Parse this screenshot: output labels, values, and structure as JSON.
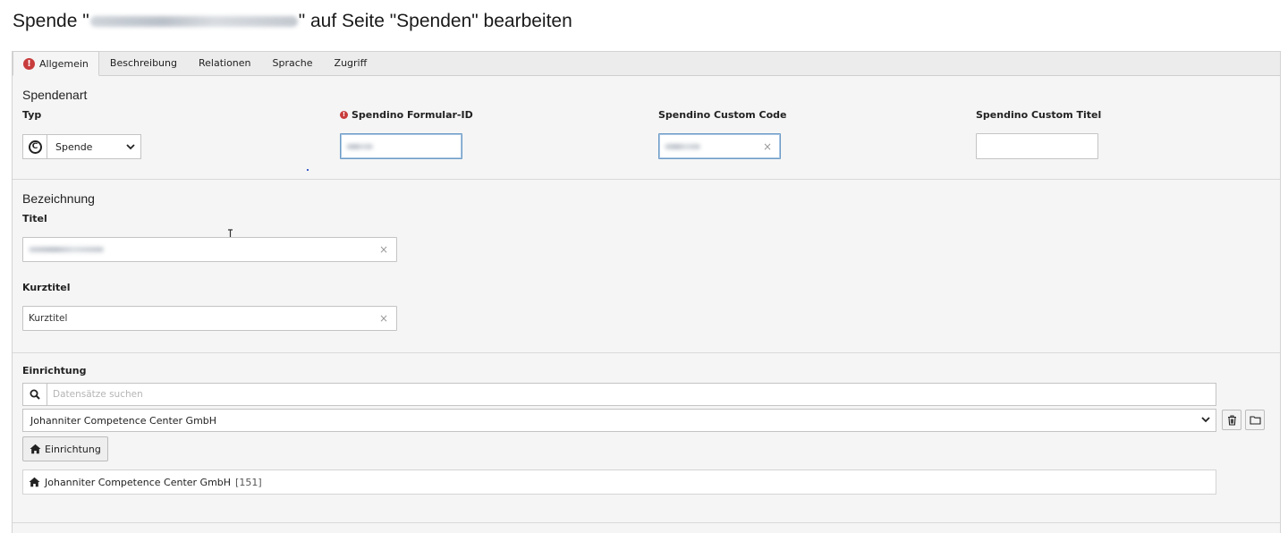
{
  "header": {
    "title_prefix": "Spende \"",
    "title_suffix": "\" auf Seite \"Spenden\" bearbeiten"
  },
  "tabs": [
    {
      "label": "Allgemein",
      "active": true,
      "has_error": true
    },
    {
      "label": "Beschreibung"
    },
    {
      "label": "Relationen"
    },
    {
      "label": "Sprache"
    },
    {
      "label": "Zugriff"
    }
  ],
  "section_spendenart": {
    "legend": "Spendenart",
    "typ": {
      "label": "Typ",
      "value": "Spende",
      "icon": "copyright-icon"
    },
    "formular_id": {
      "label": "Spendino Formular-ID",
      "required_error": true
    },
    "custom_code": {
      "label": "Spendino Custom Code"
    },
    "custom_titel": {
      "label": "Spendino Custom Titel",
      "value": ""
    }
  },
  "section_bezeichnung": {
    "legend": "Bezeichnung",
    "titel": {
      "label": "Titel"
    },
    "kurztitel": {
      "label": "Kurztitel",
      "value": "Kurztitel"
    }
  },
  "section_einrichtung": {
    "label": "Einrichtung",
    "search_placeholder": "Datensätze suchen",
    "selected_option": "Johanniter Competence Center GmbH",
    "add_button_label": "Einrichtung",
    "result": {
      "label": "Johanniter Competence Center GmbH",
      "uid": "[151]"
    }
  },
  "colors": {
    "error": "#c83c3c",
    "focus_border": "#6d9bc6",
    "form_bg": "#f5f5f5",
    "tab_bar_bg": "#ececec"
  }
}
